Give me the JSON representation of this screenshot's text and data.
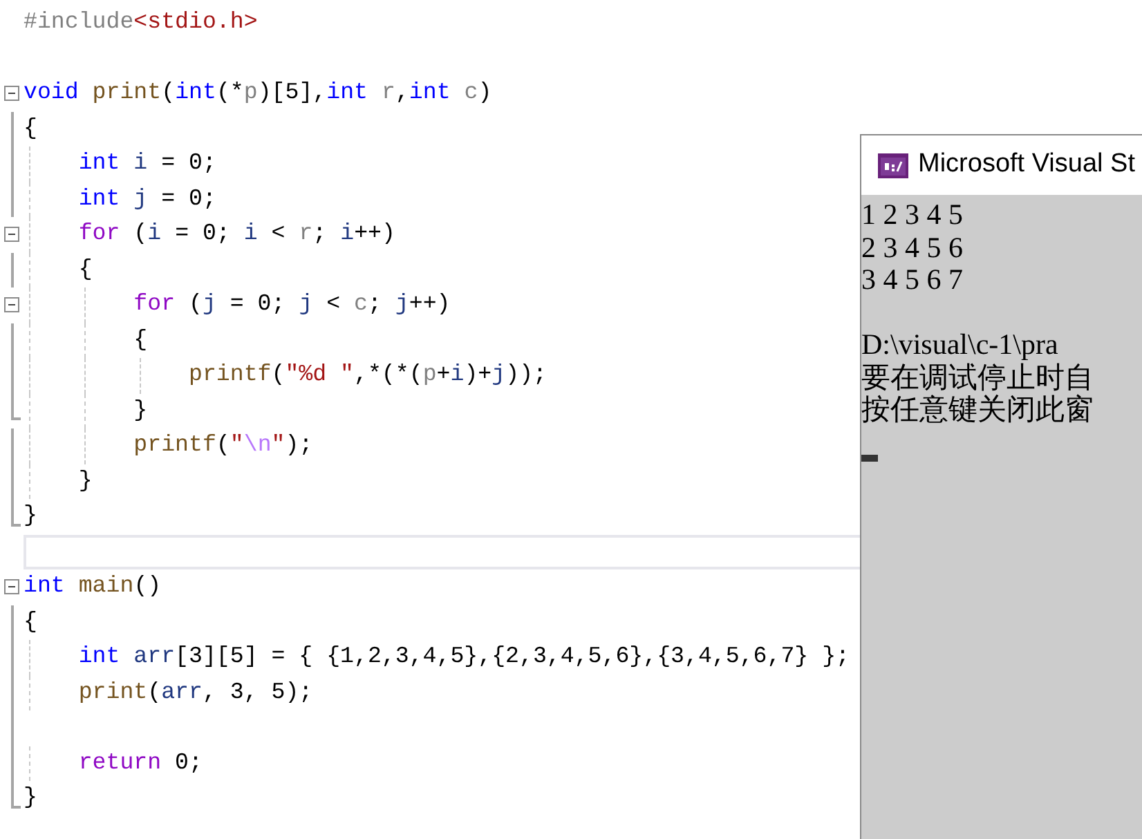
{
  "editor": {
    "lines": [
      {
        "kind": "code",
        "tokens": [
          {
            "kind": "preproc",
            "text": "#include"
          },
          {
            "kind": "header",
            "text": "<stdio.h>"
          }
        ]
      },
      {
        "kind": "blank"
      },
      {
        "kind": "code",
        "gutter": {
          "kind": "fold"
        },
        "tokens": [
          {
            "kind": "keyword",
            "text": "void "
          },
          {
            "kind": "function",
            "text": "print"
          },
          {
            "kind": "plain",
            "text": "("
          },
          {
            "kind": "keyword",
            "text": "int"
          },
          {
            "kind": "plain",
            "text": "(*"
          },
          {
            "kind": "param",
            "text": "p"
          },
          {
            "kind": "plain",
            "text": ")[5],"
          },
          {
            "kind": "keyword",
            "text": "int "
          },
          {
            "kind": "param",
            "text": "r"
          },
          {
            "kind": "plain",
            "text": ","
          },
          {
            "kind": "keyword",
            "text": "int "
          },
          {
            "kind": "param",
            "text": "c"
          },
          {
            "kind": "plain",
            "text": ")"
          }
        ]
      },
      {
        "kind": "code",
        "gutter": {
          "kind": "line"
        },
        "tokens": [
          {
            "kind": "plain",
            "text": "{"
          }
        ]
      },
      {
        "kind": "code",
        "gutter": {
          "kind": "line"
        },
        "tokens": [
          {
            "kind": "keyword",
            "text": "    int "
          },
          {
            "kind": "variable",
            "text": "i"
          },
          {
            "kind": "plain",
            "text": " = 0;"
          }
        ]
      },
      {
        "kind": "code",
        "gutter": {
          "kind": "line"
        },
        "tokens": [
          {
            "kind": "keyword",
            "text": "    int "
          },
          {
            "kind": "variable",
            "text": "j"
          },
          {
            "kind": "plain",
            "text": " = 0;"
          }
        ]
      },
      {
        "kind": "code",
        "gutter": {
          "kind": "fold"
        },
        "tokens": [
          {
            "kind": "control",
            "text": "    for"
          },
          {
            "kind": "plain",
            "text": " ("
          },
          {
            "kind": "variable",
            "text": "i"
          },
          {
            "kind": "plain",
            "text": " = 0; "
          },
          {
            "kind": "variable",
            "text": "i"
          },
          {
            "kind": "plain",
            "text": " < "
          },
          {
            "kind": "param",
            "text": "r"
          },
          {
            "kind": "plain",
            "text": "; "
          },
          {
            "kind": "variable",
            "text": "i"
          },
          {
            "kind": "plain",
            "text": "++)"
          }
        ]
      },
      {
        "kind": "code",
        "gutter": {
          "kind": "line"
        },
        "tokens": [
          {
            "kind": "plain",
            "text": "    {"
          }
        ]
      },
      {
        "kind": "code",
        "gutter": {
          "kind": "fold"
        },
        "tokens": [
          {
            "kind": "control",
            "text": "        for"
          },
          {
            "kind": "plain",
            "text": " ("
          },
          {
            "kind": "variable",
            "text": "j"
          },
          {
            "kind": "plain",
            "text": " = 0; "
          },
          {
            "kind": "variable",
            "text": "j"
          },
          {
            "kind": "plain",
            "text": " < "
          },
          {
            "kind": "param",
            "text": "c"
          },
          {
            "kind": "plain",
            "text": "; "
          },
          {
            "kind": "variable",
            "text": "j"
          },
          {
            "kind": "plain",
            "text": "++)"
          }
        ]
      },
      {
        "kind": "code",
        "gutter": {
          "kind": "line"
        },
        "tokens": [
          {
            "kind": "plain",
            "text": "        {"
          }
        ]
      },
      {
        "kind": "code",
        "gutter": {
          "kind": "line"
        },
        "tokens": [
          {
            "kind": "function",
            "text": "            printf"
          },
          {
            "kind": "plain",
            "text": "("
          },
          {
            "kind": "string",
            "text": "\"%d \""
          },
          {
            "kind": "plain",
            "text": ",*(*("
          },
          {
            "kind": "param",
            "text": "p"
          },
          {
            "kind": "plain",
            "text": "+"
          },
          {
            "kind": "variable",
            "text": "i"
          },
          {
            "kind": "plain",
            "text": ")+"
          },
          {
            "kind": "variable",
            "text": "j"
          },
          {
            "kind": "plain",
            "text": "));"
          }
        ]
      },
      {
        "kind": "code",
        "gutter": {
          "kind": "end"
        },
        "tokens": [
          {
            "kind": "plain",
            "text": "        }"
          }
        ]
      },
      {
        "kind": "code",
        "gutter": {
          "kind": "line"
        },
        "tokens": [
          {
            "kind": "function",
            "text": "        printf"
          },
          {
            "kind": "plain",
            "text": "("
          },
          {
            "kind": "string",
            "text": "\""
          },
          {
            "kind": "escape",
            "text": "\\n"
          },
          {
            "kind": "string",
            "text": "\""
          },
          {
            "kind": "plain",
            "text": ");"
          }
        ]
      },
      {
        "kind": "code",
        "gutter": {
          "kind": "line"
        },
        "tokens": [
          {
            "kind": "plain",
            "text": "    }"
          }
        ]
      },
      {
        "kind": "code",
        "gutter": {
          "kind": "end"
        },
        "tokens": [
          {
            "kind": "plain",
            "text": "}"
          }
        ]
      },
      {
        "kind": "blank",
        "current": true
      },
      {
        "kind": "code",
        "gutter": {
          "kind": "fold"
        },
        "tokens": [
          {
            "kind": "keyword",
            "text": "int "
          },
          {
            "kind": "function",
            "text": "main"
          },
          {
            "kind": "plain",
            "text": "()"
          }
        ]
      },
      {
        "kind": "code",
        "gutter": {
          "kind": "line"
        },
        "tokens": [
          {
            "kind": "plain",
            "text": "{"
          }
        ]
      },
      {
        "kind": "code",
        "gutter": {
          "kind": "line"
        },
        "tokens": [
          {
            "kind": "keyword",
            "text": "    int "
          },
          {
            "kind": "variable",
            "text": "arr"
          },
          {
            "kind": "plain",
            "text": "[3][5] = { {1,2,3,4,5},{2,3,4,5,6},{3,4,5,6,7} };"
          }
        ]
      },
      {
        "kind": "code",
        "gutter": {
          "kind": "line"
        },
        "tokens": [
          {
            "kind": "function",
            "text": "    print"
          },
          {
            "kind": "plain",
            "text": "("
          },
          {
            "kind": "variable",
            "text": "arr"
          },
          {
            "kind": "plain",
            "text": ", 3, 5);"
          }
        ]
      },
      {
        "kind": "blank",
        "gutter": {
          "kind": "line"
        }
      },
      {
        "kind": "code",
        "gutter": {
          "kind": "line"
        },
        "tokens": [
          {
            "kind": "control",
            "text": "    return"
          },
          {
            "kind": "plain",
            "text": " 0;"
          }
        ]
      },
      {
        "kind": "code",
        "gutter": {
          "kind": "end"
        },
        "tokens": [
          {
            "kind": "plain",
            "text": "}"
          }
        ]
      }
    ]
  },
  "console": {
    "title": "Microsoft Visual St",
    "output": [
      "1 2 3 4 5",
      "2 3 4 5 6",
      "3 4 5 6 7"
    ],
    "messages": [
      "D:\\visual\\c-1\\pra",
      "要在调试停止时自",
      "按任意键关闭此窗"
    ]
  }
}
